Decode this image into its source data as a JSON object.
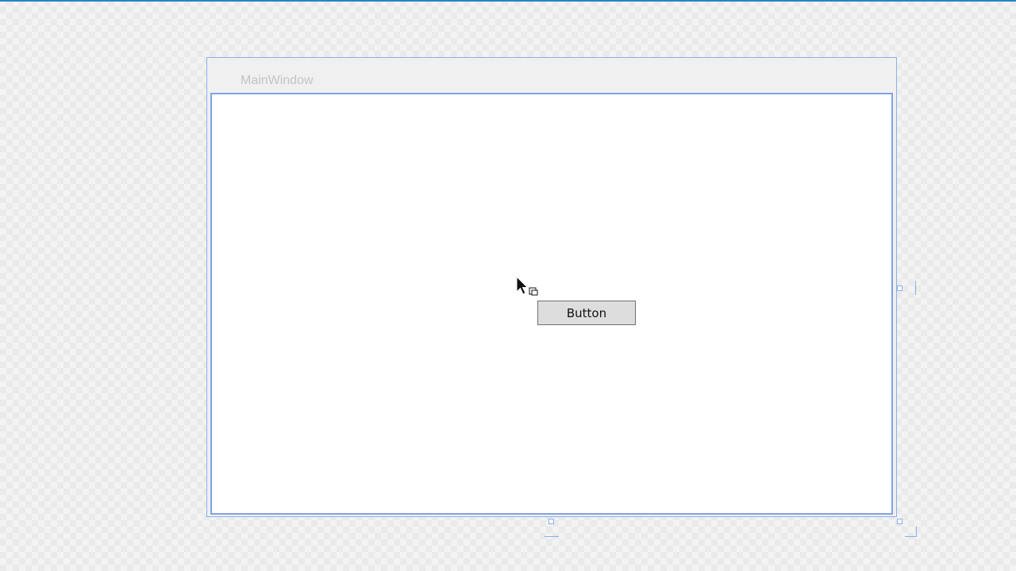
{
  "window": {
    "title": "MainWindow"
  },
  "button": {
    "label": "Button"
  },
  "colors": {
    "selection_border": "#7fa3e6",
    "button_background": "#dddddd",
    "button_border": "#707070",
    "title_text": "#c4c4c4",
    "accent_line": "#1e88c9"
  },
  "icons": {
    "cursor": "pointer-with-copy-icon"
  }
}
